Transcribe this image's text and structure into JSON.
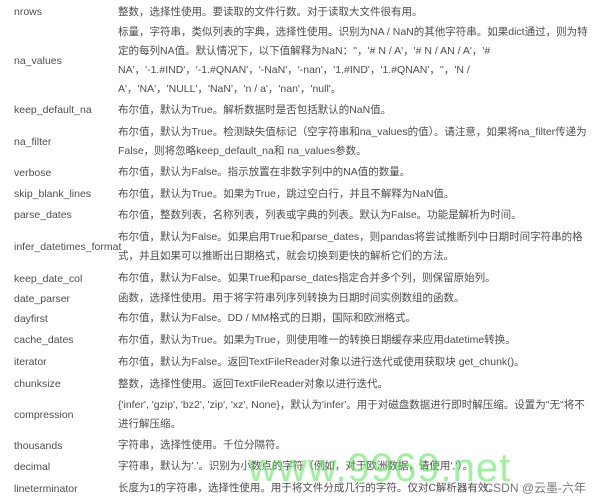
{
  "rows": [
    {
      "name": "nrows",
      "desc": "整数，选择性使用。要读取的文件行数。对于读取大文件很有用。"
    },
    {
      "name": "na_values",
      "desc": "标量，字符串，类似列表的字典，选择性使用。识别为NA / NaN的其他字符串。如果dict通过，则为特定的每列NA值。默认情况下，以下值解释为NaN：''，'# N / A'，'# N / AN / A'，'# NA'，'-1.#IND'，'-1.#QNAN'，'-NaN'，'-nan'，'1.#IND'，'1.#QNAN'，''，'N / A'，'NA'，'NULL'，'NaN'，'n / a'，'nan'，'null'。"
    },
    {
      "name": "keep_default_na",
      "desc": "布尔值，默认为True。解析数据时是否包括默认的NaN值。"
    },
    {
      "name": "na_filter",
      "desc": "布尔值，默认为True。检测缺失值标记（空字符串和na_values的值）。请注意，如果将na_filter传递为False，则将忽略keep_default_na和 na_values参数。"
    },
    {
      "name": "verbose",
      "desc": "布尔值，默认为False。指示放置在非数字列中的NA值的数量。"
    },
    {
      "name": "skip_blank_lines",
      "desc": "布尔值，默认为True。如果为True，跳过空白行，并且不解释为NaN值。"
    },
    {
      "name": "parse_dates",
      "desc": "布尔值，整数列表，名称列表，列表或字典的列表。默认为False。功能是解析为时间。"
    },
    {
      "name": "infer_datetimes_format",
      "desc": "布尔值，默认为False。如果启用True和parse_dates，则pandas将尝试推断列中日期时间字符串的格式，并且如果可以推断出日期格式，就会切换到更快的解析它们的方法。"
    },
    {
      "name": "keep_date_col",
      "desc": "布尔值，默认为False。如果True和parse_dates指定合并多个列，则保留原始列。"
    },
    {
      "name": "date_parser",
      "desc": "函数，选择性使用。用于将字符串列序列转换为日期时间实例数组的函数。"
    },
    {
      "name": "dayfirst",
      "desc": "布尔值，默认为False。DD / MM格式的日期，国际和欧洲格式。"
    },
    {
      "name": "cache_dates",
      "desc": "布尔值，默认为True。如果为True，则使用唯一的转换日期缓存来应用datetime转换。"
    },
    {
      "name": "iterator",
      "desc": "布尔值，默认为False。返回TextFileReader对象以进行迭代或使用获取块 get_chunk()。"
    },
    {
      "name": "chunksize",
      "desc": "整数，选择性使用。返回TextFileReader对象以进行迭代。"
    },
    {
      "name": "compression",
      "desc": "{'infer', 'gzip', 'bz2', 'zip', 'xz', None}，默认为'infer'。用于对磁盘数据进行即时解压缩。设置为\"无\"将不进行解压缩。"
    },
    {
      "name": "thousands",
      "desc": "字符串，选择性使用。千位分隔符。"
    },
    {
      "name": "decimal",
      "desc": "字符串，默认为'.'。识别为小数点的字符（例如，对于欧洲数据，请使用','）。"
    },
    {
      "name": "lineterminator",
      "desc": "长度为1的字符串，选择性使用。用于将文件分成几行的字符。仅对C解析器有效。"
    }
  ],
  "watermark": "www.9969.net",
  "credit": "CSDN @云墨-六年",
  "colors": {
    "text": "#4d4d4d",
    "watermark": "#50e650"
  }
}
